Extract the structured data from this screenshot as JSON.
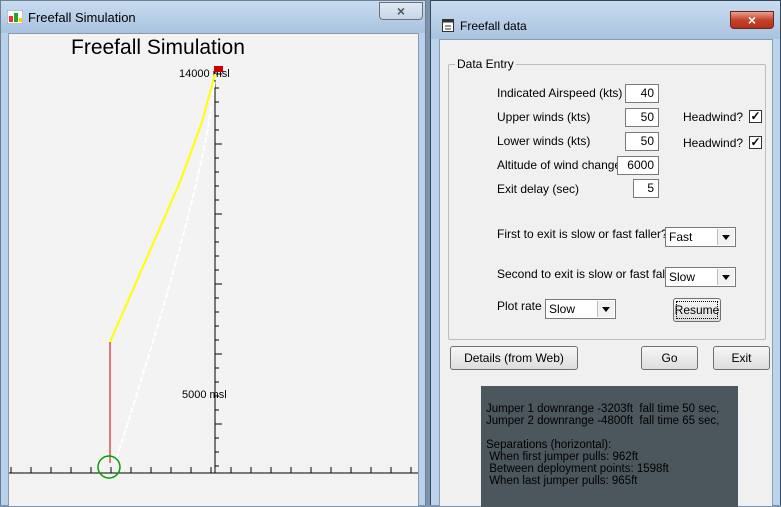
{
  "left_window": {
    "title": "Freefall Simulation",
    "close_glyph": "×",
    "plot": {
      "heading": "Freefall Simulation",
      "top_label": "14000 msl",
      "mid_label": "5000 msl"
    }
  },
  "right_window": {
    "title": "Freefall data",
    "close_glyph": "×",
    "group_caption": "Data Entry",
    "fields": {
      "airspeed": {
        "label": "Indicated Airspeed (kts)",
        "value": "40"
      },
      "upper_winds": {
        "label": "Upper winds (kts)",
        "value": "50"
      },
      "lower_winds": {
        "label": "Lower winds (kts)",
        "value": "50"
      },
      "wind_change": {
        "label": "Altitude of wind change",
        "value": "6000"
      },
      "exit_delay": {
        "label": "Exit delay (sec)",
        "value": "5"
      }
    },
    "headwind_label": "Headwind?",
    "headwind_upper_checked": "✓",
    "headwind_lower_checked": "✓",
    "first_exit": {
      "label": "First to exit is slow or fast faller?",
      "value": "Fast"
    },
    "second_exit": {
      "label": "Second to exit is slow or fast faller?",
      "value": "Slow"
    },
    "plot_rate": {
      "label": "Plot rate",
      "value": "Slow"
    },
    "buttons": {
      "resume": "Resume",
      "details": "Details (from Web)",
      "go": "Go",
      "exit": "Exit"
    },
    "results": {
      "line1": "Jumper 1 downrange -3203ft  fall time 50 sec,",
      "line2": "Jumper 2 downrange -4800ft  fall time 65 sec,",
      "line3": "Separations (horizontal):",
      "line4": " When first jumper pulls: 962ft",
      "line5": " Between deployment points: 1598ft",
      "line6": " When last jumper pulls: 965ft"
    }
  },
  "colors": {
    "jumper1_path": "#ffff00",
    "jumper2_path": "#ffffff",
    "canopy_line": "#cc0000",
    "landing_marker": "#00a000",
    "results_bg": "#4b575d"
  }
}
